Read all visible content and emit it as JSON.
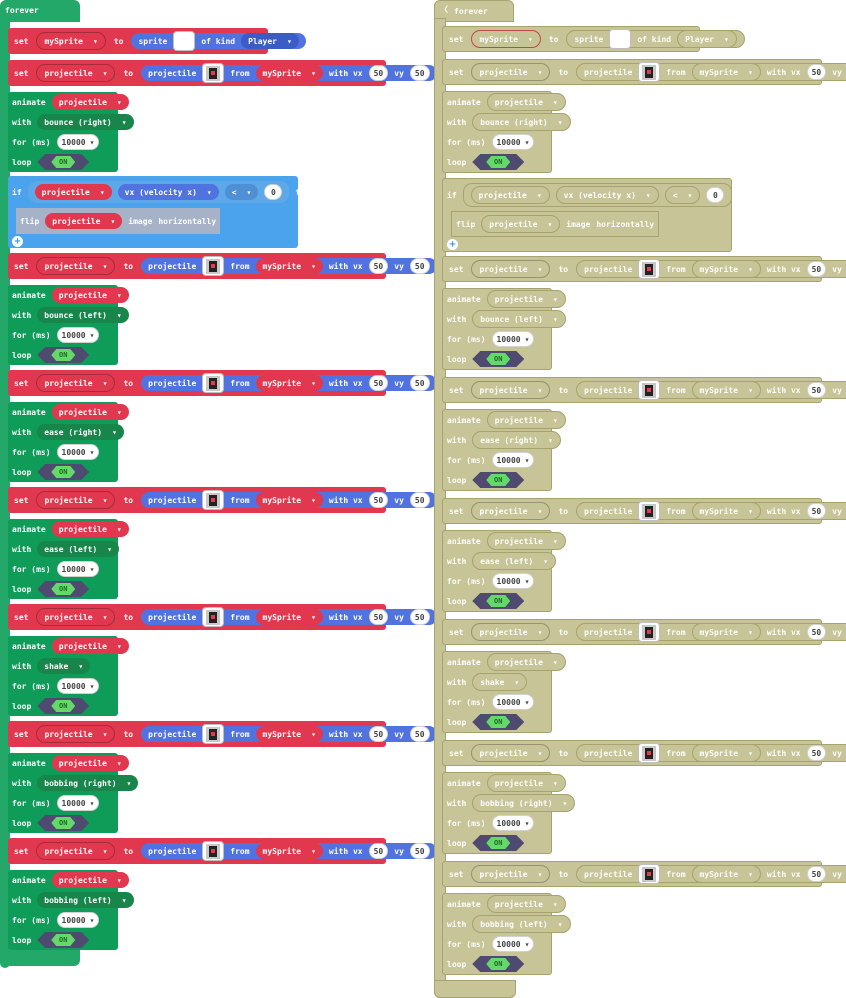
{
  "colors": {
    "loops_green": "#24a86a",
    "anim_green": "#0e9c58",
    "sprite_red": "#e2384f",
    "sprite_blue": "#5173df",
    "logic_blue": "#4aa3ec",
    "flip_gray": "#a5b2c8",
    "disabled_fill": "#c7c497",
    "disabled_border": "#a6a36e",
    "disabled_text": "#ffffff"
  },
  "labels": {
    "forever": "forever",
    "set": "set",
    "to": "to",
    "sprite": "sprite",
    "of_kind": "of kind",
    "projectile": "projectile",
    "from": "from",
    "with_vx": "with vx",
    "vy": "vy",
    "animate": "animate",
    "with": "with",
    "for_ms": "for (ms)",
    "loop": "loop",
    "on": "ON",
    "if": "if",
    "then": "then",
    "flip": "flip",
    "image": "image",
    "horizontally": "horizontally",
    "vx_prop": "vx (velocity x)",
    "op": "<",
    "zero": "0"
  },
  "vars": {
    "mySprite": "mySprite",
    "projectile": "projectile",
    "kind": "Player"
  },
  "values": {
    "vx": "50",
    "vy": "50",
    "duration": "10000"
  },
  "animations": [
    "bounce (right)",
    "bounce (left)",
    "ease (right)",
    "ease (left)",
    "shake",
    "bobbing (right)",
    "bobbing (left)"
  ]
}
